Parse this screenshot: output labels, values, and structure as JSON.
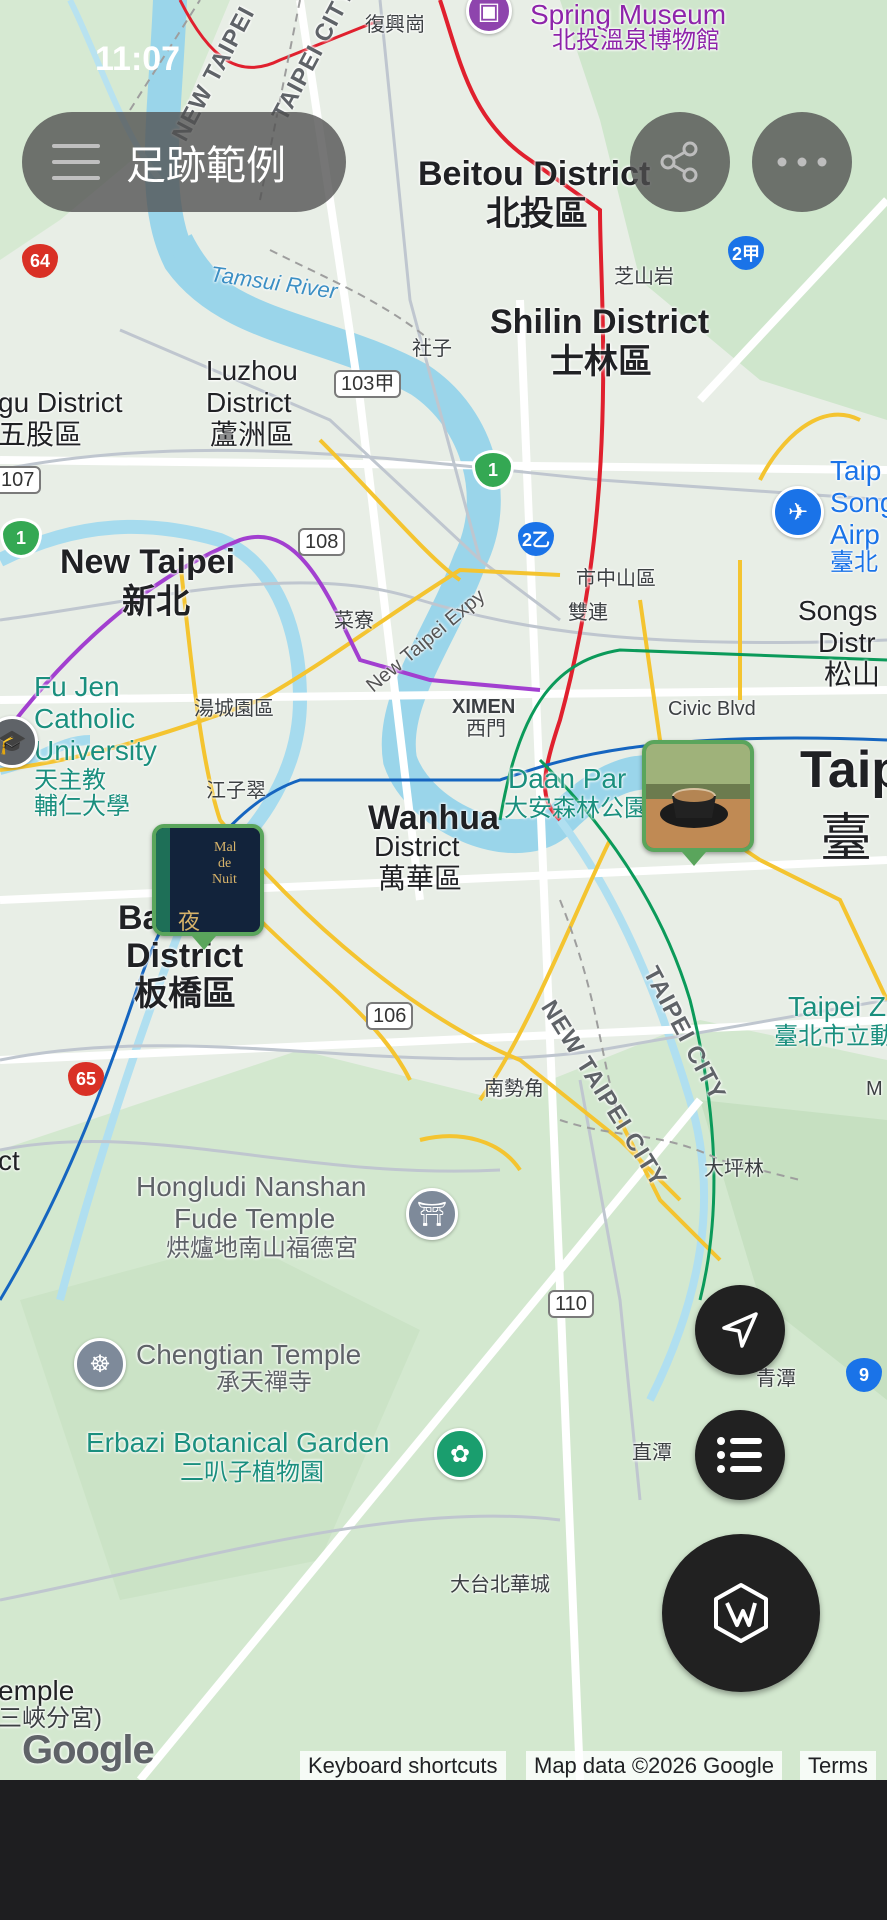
{
  "status_bar": {
    "time": "11:07"
  },
  "header": {
    "title": "足跡範例",
    "menu_icon": "hamburger-menu-icon"
  },
  "actions": {
    "share_icon": "share-icon",
    "more_icon": "more-horizontal-icon",
    "locate_icon": "navigation-arrow-icon",
    "list_icon": "list-icon",
    "logo_icon": "app-logo-icon"
  },
  "map": {
    "labels": {
      "spring_museum_en": "Spring Museum",
      "spring_museum_zh": "北投溫泉博物館",
      "fuxinggang": "復興崗",
      "beitou_en": "Beitou District",
      "beitou_zh": "北投區",
      "zhishanyan": "芝山岩",
      "tamsui_river": "Tamsui River",
      "shezi": "社子",
      "shilin_en": "Shilin District",
      "shilin_zh": "士林區",
      "luzhou_en1": "Luzhou",
      "luzhou_en2": "District",
      "luzhou_zh": "蘆洲區",
      "wugu_en": "gu District",
      "wugu_zh": "五股區",
      "newtaipei_en": "New Taipei",
      "newtaipei_zh": "新北",
      "cailiao": "菜寮",
      "expressway": "New Taipei Expy",
      "zhongshan": "市中山區",
      "shuanglian": "雙連",
      "taipei_airport_en1": "Taip",
      "taipei_airport_en2": "Song",
      "taipei_airport_en3": "Airp",
      "taipei_airport_zh": "臺北",
      "songshan_en1": "Songs",
      "songshan_en2": "Distr",
      "songshan_zh": "松山",
      "civic_blvd": "Civic Blvd",
      "ximen_en": "XIMEN",
      "ximen_zh": "西門",
      "fujen_en1": "Fu Jen",
      "fujen_en2": "Catholic",
      "fujen_en3": "University",
      "fujen_zh1": "天主教",
      "fujen_zh2": "輔仁大學",
      "tangcheng": "湯城園區",
      "jiangzicui": "江子翠",
      "daan_park_en": "Daan Par",
      "daan_park_zh": "大安森林公園",
      "taipei_big_en": "Taip",
      "taipei_big_zh": "臺",
      "wanhua_en1": "Wanhua",
      "wanhua_en2": "District",
      "wanhua_zh": "萬華區",
      "banqiao_en1": "Ba",
      "banqiao_en2": "District",
      "banqiao_zh": "板橋區",
      "taipei_city_road": "TAIPEI CITY",
      "newtaipei_city_road": "NEW TAIPEI CITY",
      "newtaipei_city_top": "NEW TAIPEI",
      "taipei_city_top": "TAIPEI CITY",
      "taipei_zoo_en": "Taipei Z",
      "taipei_zoo_zh": "臺北市立動",
      "nanshijiao": "南勢角",
      "dapinglin": "大坪林",
      "honglu_en1": "Hongludi Nanshan",
      "honglu_en2": "Fude Temple",
      "honglu_zh": "烘爐地南山福德宮",
      "chengtian_en": "Chengtian Temple",
      "chengtian_zh": "承天禪寺",
      "qingtan": "青潭",
      "erbazi_en": "Erbazi Botanical Garden",
      "erbazi_zh": "二叭子植物園",
      "zhitan": "直潭",
      "dataibei": "大台北華城",
      "temple_cut_en": "emple",
      "temple_cut_zh": "三峽分宮)",
      "ct_cut": "ct",
      "m_cut": "M"
    },
    "shields": {
      "r103": "103甲",
      "r108": "108",
      "r107": "107",
      "r106": "106",
      "r110": "110",
      "r2b": "2乙",
      "r2a": "2甲",
      "r64": "64",
      "r65": "65",
      "r1": "1",
      "r1b": "1",
      "r9": "9"
    },
    "pins": {
      "coffee_photo": "coffee-photo-pin",
      "book_photo": "book-photo-pin",
      "book_text1": "Mal",
      "book_text2": "de",
      "book_text3": "Nuit",
      "book_zh": "夜"
    }
  },
  "footer": {
    "google_logo": "Google",
    "keyboard_shortcuts": "Keyboard shortcuts",
    "map_data": "Map data ©2026 Google",
    "terms": "Terms"
  },
  "colors": {
    "river": "#8fd3e8",
    "mrt_green": "#0b9a5a",
    "mrt_blue": "#1565c0",
    "mrt_purple": "#a23fd0",
    "mrt_red": "#e0202e",
    "road_yellow": "#f4c430",
    "pin_green": "#5aa55c",
    "fab": "#212121"
  }
}
